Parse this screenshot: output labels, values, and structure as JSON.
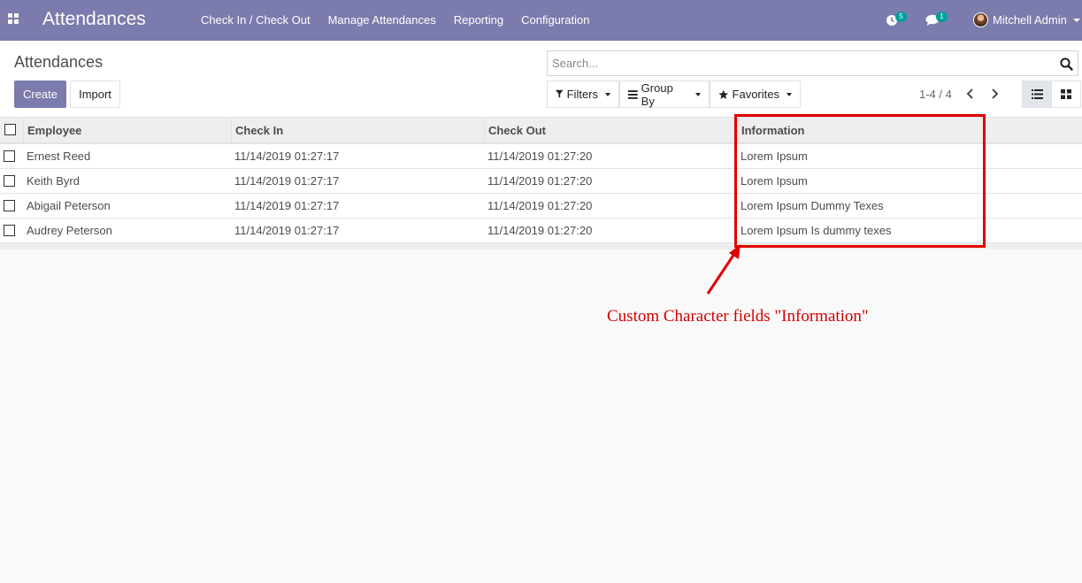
{
  "navbar": {
    "app_title": "Attendances",
    "menu": [
      "Check In / Check Out",
      "Manage Attendances",
      "Reporting",
      "Configuration"
    ],
    "activity_count": "5",
    "messages_count": "1",
    "user_name": "Mitchell Admin",
    "color": "#7c7bad",
    "badge_color": "#00a09d"
  },
  "control_panel": {
    "breadcrumb": "Attendances",
    "create_label": "Create",
    "import_label": "Import",
    "search_placeholder": "Search...",
    "filters_label": "Filters",
    "group_by_label": "Group By",
    "favorites_label": "Favorites",
    "pager": "1-4 / 4",
    "active_view": "list"
  },
  "table": {
    "columns": [
      "Employee",
      "Check In",
      "Check Out",
      "Information"
    ],
    "rows": [
      [
        "Ernest Reed",
        "11/14/2019 01:27:17",
        "11/14/2019 01:27:20",
        "Lorem Ipsum"
      ],
      [
        "Keith Byrd",
        "11/14/2019 01:27:17",
        "11/14/2019 01:27:20",
        "Lorem Ipsum"
      ],
      [
        "Abigail Peterson",
        "11/14/2019 01:27:17",
        "11/14/2019 01:27:20",
        "Lorem Ipsum Dummy Texes"
      ],
      [
        "Audrey Peterson",
        "11/14/2019 01:27:17",
        "11/14/2019 01:27:20",
        "Lorem Ipsum Is dummy texes"
      ]
    ]
  },
  "annotation": {
    "text": "Custom Character fields \"Information\"",
    "color": "#d40000"
  }
}
